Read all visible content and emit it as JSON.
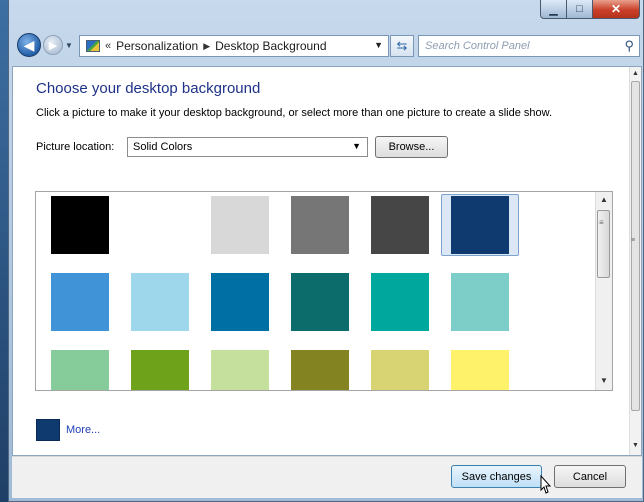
{
  "address_bar": {
    "crumb_overflow": "«",
    "crumbs": [
      "Personalization",
      "Desktop Background"
    ]
  },
  "search": {
    "placeholder": "Search Control Panel"
  },
  "page": {
    "title": "Choose your desktop background",
    "subtitle": "Click a picture to make it your desktop background, or select more than one picture to create a slide show.",
    "picture_location_label": "Picture location:",
    "picture_location_value": "Solid Colors",
    "browse_label": "Browse...",
    "more_label": "More...",
    "more_color": "#0e3a70"
  },
  "swatch_rows": [
    [
      "#000000",
      "#ffffff",
      "#d8d8d8",
      "#767676",
      "#464646",
      "#0e3a70"
    ],
    [
      "#3f93d6",
      "#9ed7eb",
      "#0070a4",
      "#0c6b6b",
      "#00a79d",
      "#7dcdc8"
    ],
    [
      "#86cb9a",
      "#6da21a",
      "#c5e09d",
      "#838322",
      "#d8d474",
      "#fff26b"
    ]
  ],
  "selected_swatch": "#0e3a70",
  "footer": {
    "save_label": "Save changes",
    "cancel_label": "Cancel"
  }
}
